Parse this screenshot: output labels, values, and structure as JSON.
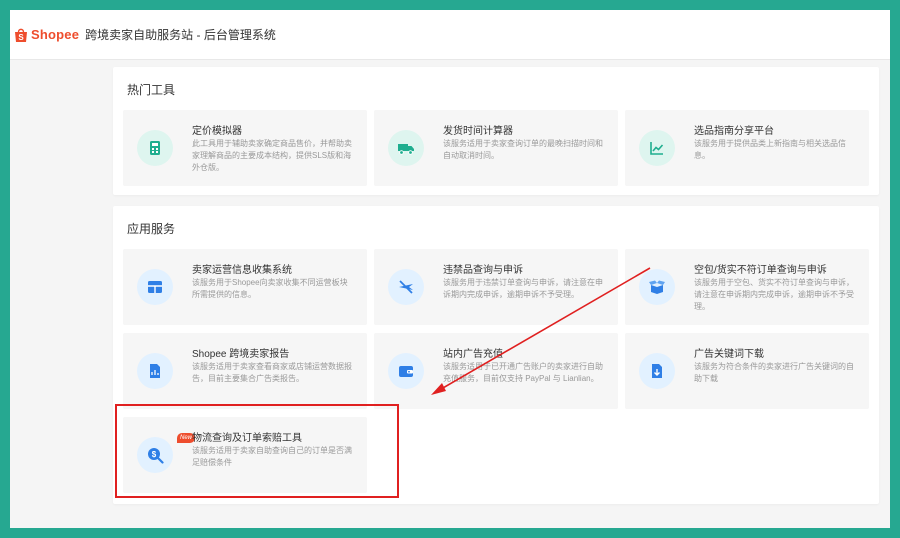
{
  "header": {
    "logo_text": "Shopee",
    "title": "跨境卖家自助服务站 - 后台管理系统"
  },
  "hot_tools": {
    "title": "热门工具",
    "cards": [
      {
        "title": "定价模拟器",
        "desc": "此工具用于辅助卖家确定商品售价，并帮助卖家理解商品的主要成本结构，提供SLS版和海外仓版。",
        "icon": "calculator-icon"
      },
      {
        "title": "发货时间计算器",
        "desc": "该服务适用于卖家查询订单的最晚扫描时间和自动取消时间。",
        "icon": "truck-icon"
      },
      {
        "title": "选品指南分享平台",
        "desc": "该服务用于提供品类上新指南与相关选品信息。",
        "icon": "trend-chart-icon"
      }
    ]
  },
  "app_services": {
    "title": "应用服务",
    "cards": [
      {
        "title": "卖家运营信息收集系统",
        "desc": "该服务用于Shopee向卖家收集不同运营板块所需提供的信息。",
        "icon": "grid-table-icon"
      },
      {
        "title": "违禁品查询与申诉",
        "desc": "该服务用于违禁订单查询与申诉，请注意在申诉期内完成申诉，逾期申诉不予受理。",
        "icon": "prohibited-plane-icon"
      },
      {
        "title": "空包/货实不符订单查询与申诉",
        "desc": "该服务用于空包、货实不符订单查询与申诉，请注意在申诉期内完成申诉，逾期申诉不予受理。",
        "icon": "open-box-icon"
      },
      {
        "title": "Shopee 跨境卖家报告",
        "desc": "该服务适用于卖家查看商家或店铺运营数据报告，目前主要集合广告类报告。",
        "icon": "report-document-icon"
      },
      {
        "title": "站内广告充值",
        "desc": "该服务适用于已开通广告账户的卖家进行自助充值服务，目前仅支持 PayPal 与 Lianlian。",
        "icon": "wallet-icon"
      },
      {
        "title": "广告关键词下载",
        "desc": "该服务为符合条件的卖家进行广告关键词的自助下载",
        "icon": "download-file-icon"
      },
      {
        "title": "物流查询及订单索赔工具",
        "desc": "该服务适用于卖家自助查询自己的订单是否满足赔偿条件",
        "icon": "money-search-icon",
        "badge": "New"
      }
    ]
  },
  "colors": {
    "brand": "#ee4d2d",
    "icon_blue": "#2f7fe6",
    "icon_green": "#1fae8f",
    "annotation_red": "#e02020",
    "frame_bg": "#26a891"
  }
}
